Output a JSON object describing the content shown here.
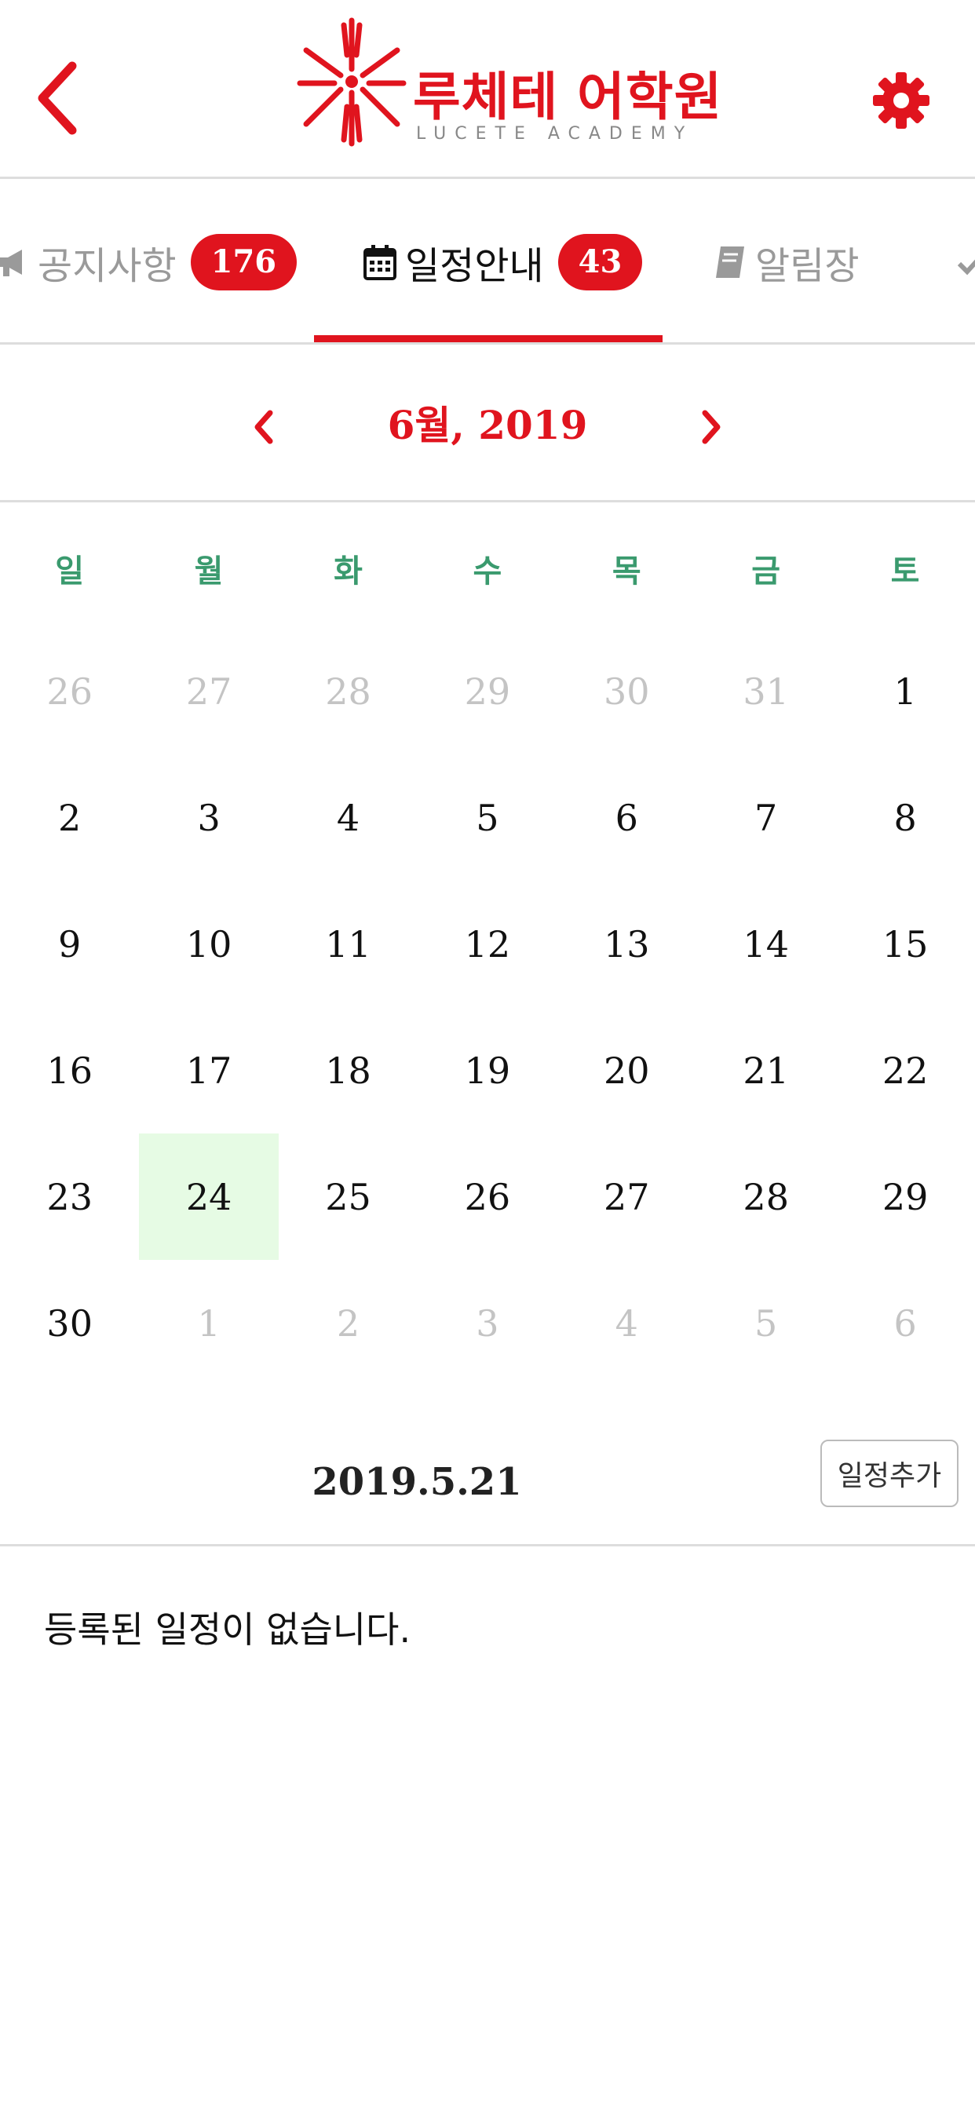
{
  "header": {
    "logo_name": "루체테 어학원",
    "logo_sub": "LUCETE ACADEMY",
    "brand_color": "#e0141e",
    "back_icon": "chevron-left-icon",
    "settings_icon": "gear-icon"
  },
  "tabs": [
    {
      "label": "공지사항",
      "badge": "176",
      "icon": "megaphone-icon",
      "active": false
    },
    {
      "label": "일정안내",
      "badge": "43",
      "icon": "calendar-icon",
      "active": true
    },
    {
      "label": "알림장",
      "badge": "",
      "icon": "book-icon",
      "active": false
    }
  ],
  "calendar": {
    "month_title": "6월, 2019",
    "weekdays": [
      "일",
      "월",
      "화",
      "수",
      "목",
      "금",
      "토"
    ],
    "days": [
      {
        "d": "26",
        "other": true
      },
      {
        "d": "27",
        "other": true
      },
      {
        "d": "28",
        "other": true
      },
      {
        "d": "29",
        "other": true
      },
      {
        "d": "30",
        "other": true
      },
      {
        "d": "31",
        "other": true
      },
      {
        "d": "1"
      },
      {
        "d": "2"
      },
      {
        "d": "3"
      },
      {
        "d": "4"
      },
      {
        "d": "5"
      },
      {
        "d": "6"
      },
      {
        "d": "7"
      },
      {
        "d": "8"
      },
      {
        "d": "9"
      },
      {
        "d": "10"
      },
      {
        "d": "11"
      },
      {
        "d": "12"
      },
      {
        "d": "13"
      },
      {
        "d": "14"
      },
      {
        "d": "15"
      },
      {
        "d": "16"
      },
      {
        "d": "17"
      },
      {
        "d": "18"
      },
      {
        "d": "19"
      },
      {
        "d": "20"
      },
      {
        "d": "21"
      },
      {
        "d": "22"
      },
      {
        "d": "23"
      },
      {
        "d": "24",
        "today": true
      },
      {
        "d": "25"
      },
      {
        "d": "26"
      },
      {
        "d": "27"
      },
      {
        "d": "28"
      },
      {
        "d": "29"
      },
      {
        "d": "30"
      },
      {
        "d": "1",
        "other": true
      },
      {
        "d": "2",
        "other": true
      },
      {
        "d": "3",
        "other": true
      },
      {
        "d": "4",
        "other": true
      },
      {
        "d": "5",
        "other": true
      },
      {
        "d": "6",
        "other": true
      }
    ],
    "today_color": "#e6fbe4",
    "weekday_color": "#3a9a6e"
  },
  "schedule": {
    "selected_date": "2019.5.21",
    "add_label": "일정추가",
    "empty_message": "등록된 일정이 없습니다."
  }
}
